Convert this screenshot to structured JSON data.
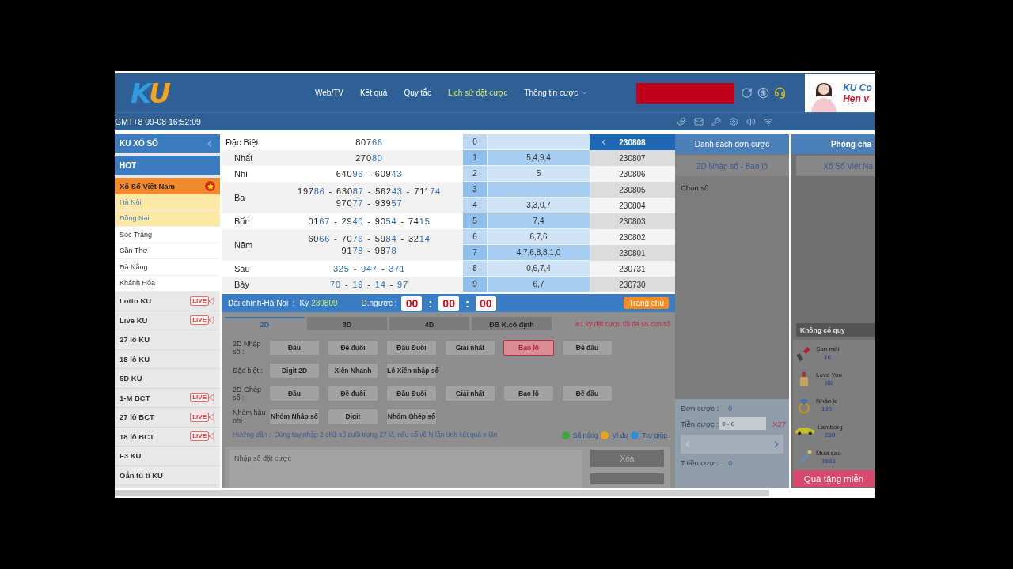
{
  "header": {
    "logo": "KU",
    "nav": [
      {
        "label": "Web/TV",
        "selected": false,
        "dropdown": false
      },
      {
        "label": "Kết quả",
        "selected": false,
        "dropdown": false
      },
      {
        "label": "Quy tắc",
        "selected": false,
        "dropdown": false
      },
      {
        "label": "Lịch sử đặt cược",
        "selected": true,
        "dropdown": false
      },
      {
        "label": "Thông tin cược",
        "selected": false,
        "dropdown": true
      }
    ],
    "banner": [
      "KU Co",
      "Hẹn v"
    ],
    "clock": "GMT+8 09-08 16:52:09"
  },
  "sidebar": {
    "title": "KU XỔ SỐ",
    "hot": "HOT",
    "group": {
      "label": "Xổ Số Việt Nam",
      "expanded": true,
      "children": [
        {
          "label": "Hà Nội",
          "highlighted": true
        },
        {
          "label": "Đồng Nai",
          "highlighted": true
        },
        {
          "label": "Sóc Trăng",
          "highlighted": false
        },
        {
          "label": "Cần Thơ",
          "highlighted": false
        },
        {
          "label": "Đà Nẵng",
          "highlighted": false
        },
        {
          "label": "Khánh Hòa",
          "highlighted": false
        }
      ]
    },
    "games": [
      {
        "label": "Lotto KU",
        "badge": "LIVE"
      },
      {
        "label": "Live KU",
        "badge": "LIVE"
      },
      {
        "label": "27 lô KU"
      },
      {
        "label": "18 lô KU"
      },
      {
        "label": "5D KU"
      },
      {
        "label": "1-M BCT",
        "badge": "LIVE"
      },
      {
        "label": "27 lô BCT",
        "badge": "LIVE"
      },
      {
        "label": "18 lô BCT",
        "badge": "LIVE"
      },
      {
        "label": "F3 KU"
      },
      {
        "label": "Oẳn tù tì KU"
      }
    ]
  },
  "results": {
    "separator": "-",
    "prizes": [
      {
        "name": "Đặc Biệt",
        "lines": [
          [
            "80766"
          ]
        ]
      },
      {
        "name": "Nhất",
        "lines": [
          [
            "27080"
          ]
        ]
      },
      {
        "name": "Nhì",
        "lines": [
          [
            "64096",
            "60943"
          ]
        ]
      },
      {
        "name": "Ba",
        "lines": [
          [
            "19786",
            "63087",
            "56243",
            "71174"
          ],
          [
            "97077",
            "93957"
          ]
        ]
      },
      {
        "name": "Bốn",
        "lines": [
          [
            "0167",
            "2940",
            "9054",
            "7415"
          ]
        ]
      },
      {
        "name": "Năm",
        "lines": [
          [
            "6066",
            "7076",
            "5984",
            "3214"
          ],
          [
            "9178",
            "9878"
          ]
        ]
      },
      {
        "name": "Sáu",
        "lines": [
          [
            "325",
            "947",
            "371"
          ]
        ]
      },
      {
        "name": "Bảy",
        "lines": [
          [
            "70",
            "19",
            "14",
            "97"
          ]
        ]
      }
    ],
    "heads": [
      {
        "digit": "0"
      },
      {
        "digit": "1",
        "values": "5,4,9,4"
      },
      {
        "digit": "2",
        "values": "5"
      },
      {
        "digit": "3"
      },
      {
        "digit": "4",
        "values": "3,3,0,7"
      },
      {
        "digit": "5",
        "values": "7,4"
      },
      {
        "digit": "6",
        "values": "6,7,6"
      },
      {
        "digit": "7",
        "values": "4,7,6,8,8,1,0"
      },
      {
        "digit": "8",
        "values": "0,6,7,4"
      },
      {
        "digit": "9",
        "values": "6,7"
      }
    ],
    "periods": [
      {
        "label": "230808",
        "selected": true
      },
      {
        "label": "230807",
        "selected": false
      },
      {
        "label": "230806",
        "selected": false
      },
      {
        "label": "230805",
        "selected": false
      },
      {
        "label": "230804",
        "selected": false
      },
      {
        "label": "230803",
        "selected": false
      },
      {
        "label": "230802",
        "selected": false
      },
      {
        "label": "230801",
        "selected": false
      },
      {
        "label": "230731",
        "selected": false
      },
      {
        "label": "230730",
        "selected": false
      }
    ]
  },
  "draw": {
    "station": "Đài chính-Hà Nội  :",
    "period_label": "Kỳ",
    "period": "230809",
    "countdown_label": "Đ.ngược :",
    "countdown": [
      "00",
      "00",
      "00"
    ],
    "countdown_separator": ":",
    "home_button": "Trang chủ"
  },
  "betting": {
    "tabs": [
      {
        "label": "2D",
        "selected": true
      },
      {
        "label": "3D",
        "selected": false
      },
      {
        "label": "4D",
        "selected": false
      },
      {
        "label": "ĐB K.cố định",
        "selected": false
      }
    ],
    "limit_note": "※1 kỳ đặt cược tối đa 65 con số",
    "rows": [
      {
        "label": "2D Nhập số :",
        "options": [
          {
            "label": "Đầu",
            "selected": false
          },
          {
            "label": "Đề đuôi",
            "selected": false
          },
          {
            "label": "Đầu Đuôi",
            "selected": false
          },
          {
            "label": "Giải nhất",
            "selected": false
          },
          {
            "label": "Bao lô",
            "selected": true
          },
          {
            "label": "Đề đầu",
            "selected": false
          }
        ]
      },
      {
        "label": "Đặc biệt :",
        "options": [
          {
            "label": "Digit 2D",
            "selected": false
          },
          {
            "label": "Xiên Nhanh",
            "selected": false
          },
          {
            "label": "Lô Xiên nhập số",
            "selected": false
          }
        ]
      },
      {
        "label": "2D Ghép số :",
        "options": [
          {
            "label": "Đầu",
            "selected": false
          },
          {
            "label": "Đề đuôi",
            "selected": false
          },
          {
            "label": "Đầu Đuôi",
            "selected": false
          },
          {
            "label": "Giải nhất",
            "selected": false
          },
          {
            "label": "Bao lô",
            "selected": false
          },
          {
            "label": "Đề đầu",
            "selected": false
          }
        ]
      },
      {
        "label": "Nhóm hậu nhị :",
        "options": [
          {
            "label": "Nhóm Nhập số",
            "selected": false
          },
          {
            "label": "Digit",
            "selected": false
          },
          {
            "label": "Nhóm Ghép số",
            "selected": false
          }
        ]
      }
    ],
    "guide": "Hướng dẫn：Dùng tay nhập 2 chữ số cuối trong 27 lô, nếu số về N lần tính kết quả x lần",
    "links": [
      {
        "label": "Số nóng",
        "color": "#3aa83a"
      },
      {
        "label": "Ví dụ",
        "color": "#e8a317"
      },
      {
        "label": "Trợ giúp",
        "color": "#2f8fd8"
      }
    ],
    "input": {
      "placeholder": "Nhập số đặt cược"
    },
    "clear_button": "Xóa"
  },
  "slip": {
    "title": "Danh sách đơn cược",
    "bet_type": "2D Nhập số - Bao lô",
    "choose": "Chọn số",
    "count_label": "Đơn cược :",
    "count": "0",
    "amount_label": "Tiền cược :",
    "amount_placeholder": "0 - 0",
    "multiplier": "X27",
    "total_label": "T.tiền cược :",
    "total": "0"
  },
  "chat": {
    "title": "Phòng cha",
    "room": "Xổ Số Việt Na",
    "notice": "Không có quy",
    "gifts": [
      {
        "kind": "lipstick",
        "name": "Son môi",
        "price": "16"
      },
      {
        "kind": "perfume",
        "name": "Love You",
        "price": "88"
      },
      {
        "kind": "ring",
        "name": "Nhẫn ki",
        "price": "130"
      },
      {
        "kind": "car",
        "name": "Lamborg",
        "price": "280"
      },
      {
        "kind": "meteor",
        "name": "Mưa sao",
        "price": "1688"
      }
    ],
    "free_gifts": "Quà tặng miễn"
  }
}
